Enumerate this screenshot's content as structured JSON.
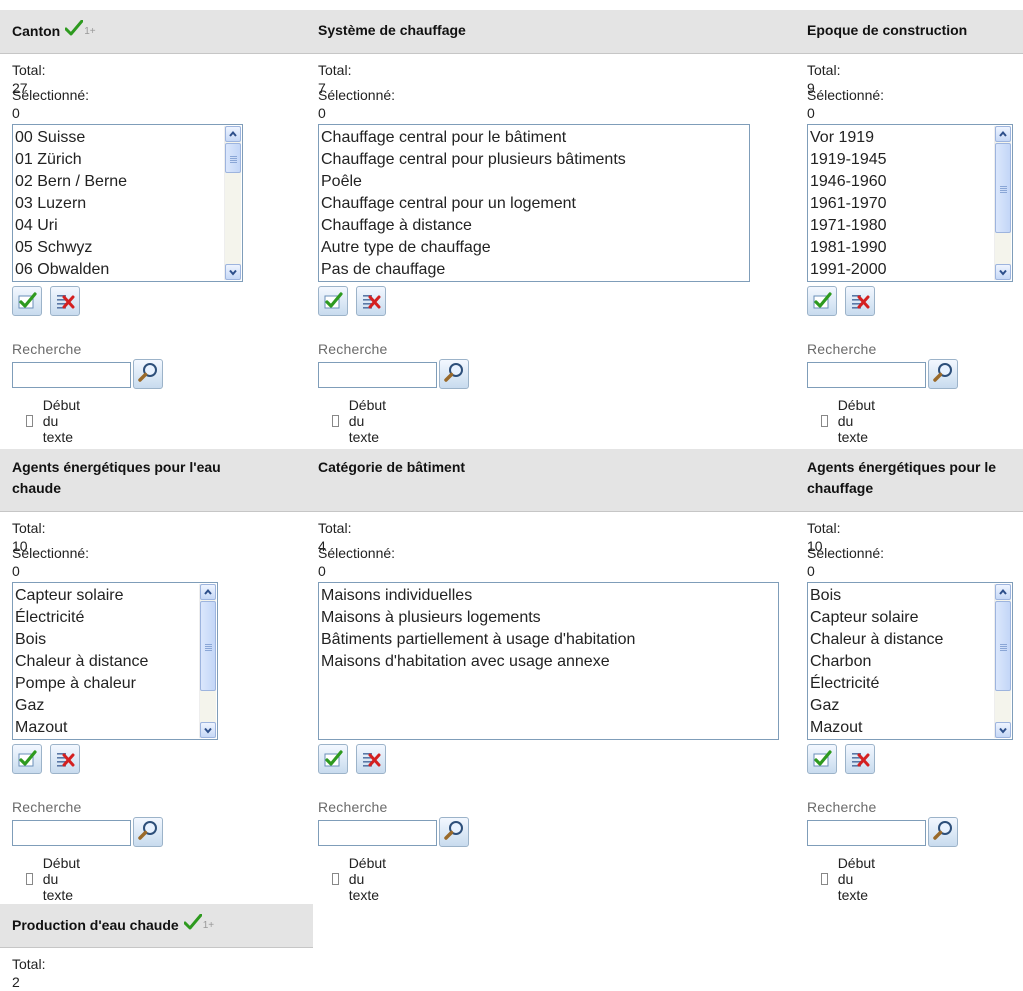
{
  "common": {
    "total_prefix": "Total: ",
    "selected_prefix": "Sélectionné: ",
    "search_label": "Recherche",
    "search_placeholder": "",
    "starts_with_label": "Début du texte",
    "badge_text": "1+"
  },
  "colors": {
    "header_bg": "#e4e4e4",
    "accent_check": "#2e9a1f",
    "clear_x": "#d42020",
    "listbox_border": "#7f9db9"
  },
  "panels": [
    {
      "title": "Canton",
      "badge": true,
      "total": "27",
      "selected": "0",
      "items": [
        "00 Suisse",
        "01 Zürich",
        "02 Bern / Berne",
        "03 Luzern",
        "04 Uri",
        "05 Schwyz",
        "06 Obwalden"
      ]
    },
    {
      "title": "Système de chauffage",
      "badge": false,
      "total": "7",
      "selected": "0",
      "items": [
        "Chauffage central pour le bâtiment",
        "Chauffage central pour plusieurs bâtiments",
        "Poêle",
        "Chauffage central pour un logement",
        "Chauffage à distance",
        "Autre type de chauffage",
        "Pas de chauffage"
      ]
    },
    {
      "title": "Epoque de construction",
      "badge": false,
      "total": "9",
      "selected": "0",
      "items": [
        "Vor 1919",
        "1919-1945",
        "1946-1960",
        "1961-1970",
        "1971-1980",
        "1981-1990",
        "1991-2000"
      ]
    },
    {
      "title": "Agents énergétiques pour l'eau chaude",
      "badge": false,
      "total": "10",
      "selected": "0",
      "items": [
        "Capteur solaire",
        "Électricité",
        "Bois",
        "Chaleur à distance",
        "Pompe à chaleur",
        "Gaz",
        "Mazout"
      ]
    },
    {
      "title": "Catégorie de bâtiment",
      "badge": false,
      "total": "4",
      "selected": "0",
      "items": [
        "Maisons individuelles",
        "Maisons à plusieurs logements",
        "Bâtiments partiellement à usage d'habitation",
        "Maisons d'habitation avec usage annexe"
      ]
    },
    {
      "title": "Agents énergétiques pour le chauffage",
      "badge": false,
      "total": "10",
      "selected": "0",
      "items": [
        "Bois",
        "Capteur solaire",
        "Chaleur à distance",
        "Charbon",
        "Électricité",
        "Gaz",
        "Mazout"
      ]
    },
    {
      "title": "Production d'eau chaude",
      "badge": true,
      "total": "2",
      "selected": "",
      "items": []
    }
  ]
}
